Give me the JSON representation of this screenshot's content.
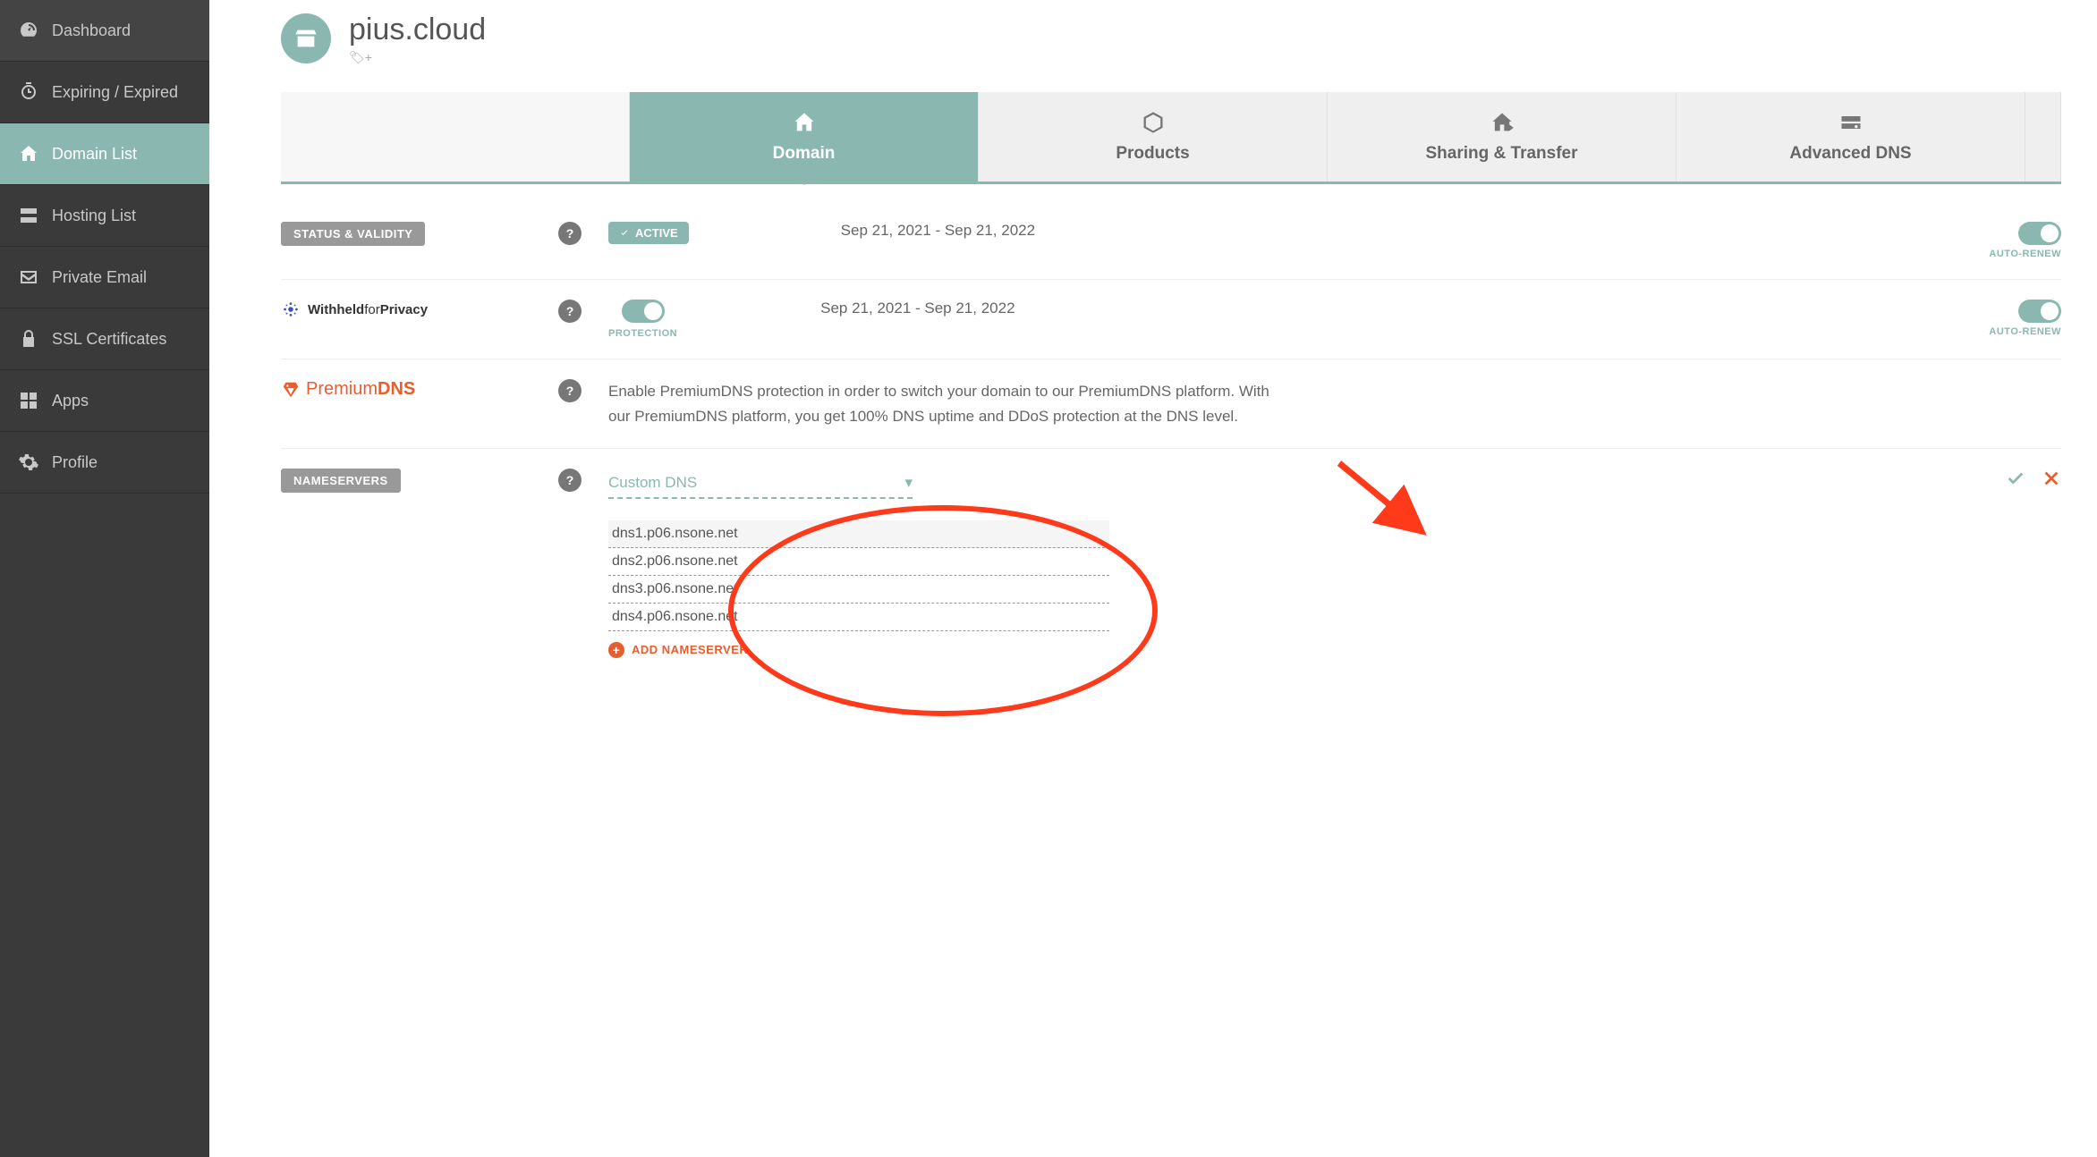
{
  "sidebar": {
    "items": [
      {
        "label": "Dashboard"
      },
      {
        "label": "Expiring / Expired"
      },
      {
        "label": "Domain List"
      },
      {
        "label": "Hosting List"
      },
      {
        "label": "Private Email"
      },
      {
        "label": "SSL Certificates"
      },
      {
        "label": "Apps"
      },
      {
        "label": "Profile"
      }
    ]
  },
  "header": {
    "domain_name": "pius.cloud"
  },
  "tabs": [
    {
      "label": "Domain"
    },
    {
      "label": "Products"
    },
    {
      "label": "Sharing & Transfer"
    },
    {
      "label": "Advanced DNS"
    }
  ],
  "status": {
    "section_label": "STATUS & VALIDITY",
    "active_label": "ACTIVE",
    "date_range": "Sep 21, 2021 - Sep 21, 2022",
    "auto_renew_label": "AUTO-RENEW"
  },
  "privacy": {
    "brand_bold": "Withheld",
    "brand_mid": "for",
    "brand_end": "Privacy",
    "protection_label": "PROTECTION",
    "date_range": "Sep 21, 2021 - Sep 21, 2022",
    "auto_renew_label": "AUTO-RENEW"
  },
  "premium": {
    "brand_prefix": "Premium",
    "brand_suffix": "DNS",
    "description": "Enable PremiumDNS protection in order to switch your domain to our PremiumDNS platform. With our PremiumDNS platform, you get 100% DNS uptime and DDoS protection at the DNS level."
  },
  "nameservers": {
    "section_label": "NAMESERVERS",
    "select_label": "Custom DNS",
    "servers": [
      "dns1.p06.nsone.net",
      "dns2.p06.nsone.net",
      "dns3.p06.nsone.net",
      "dns4.p06.nsone.net"
    ],
    "add_label": "ADD NAMESERVER"
  }
}
